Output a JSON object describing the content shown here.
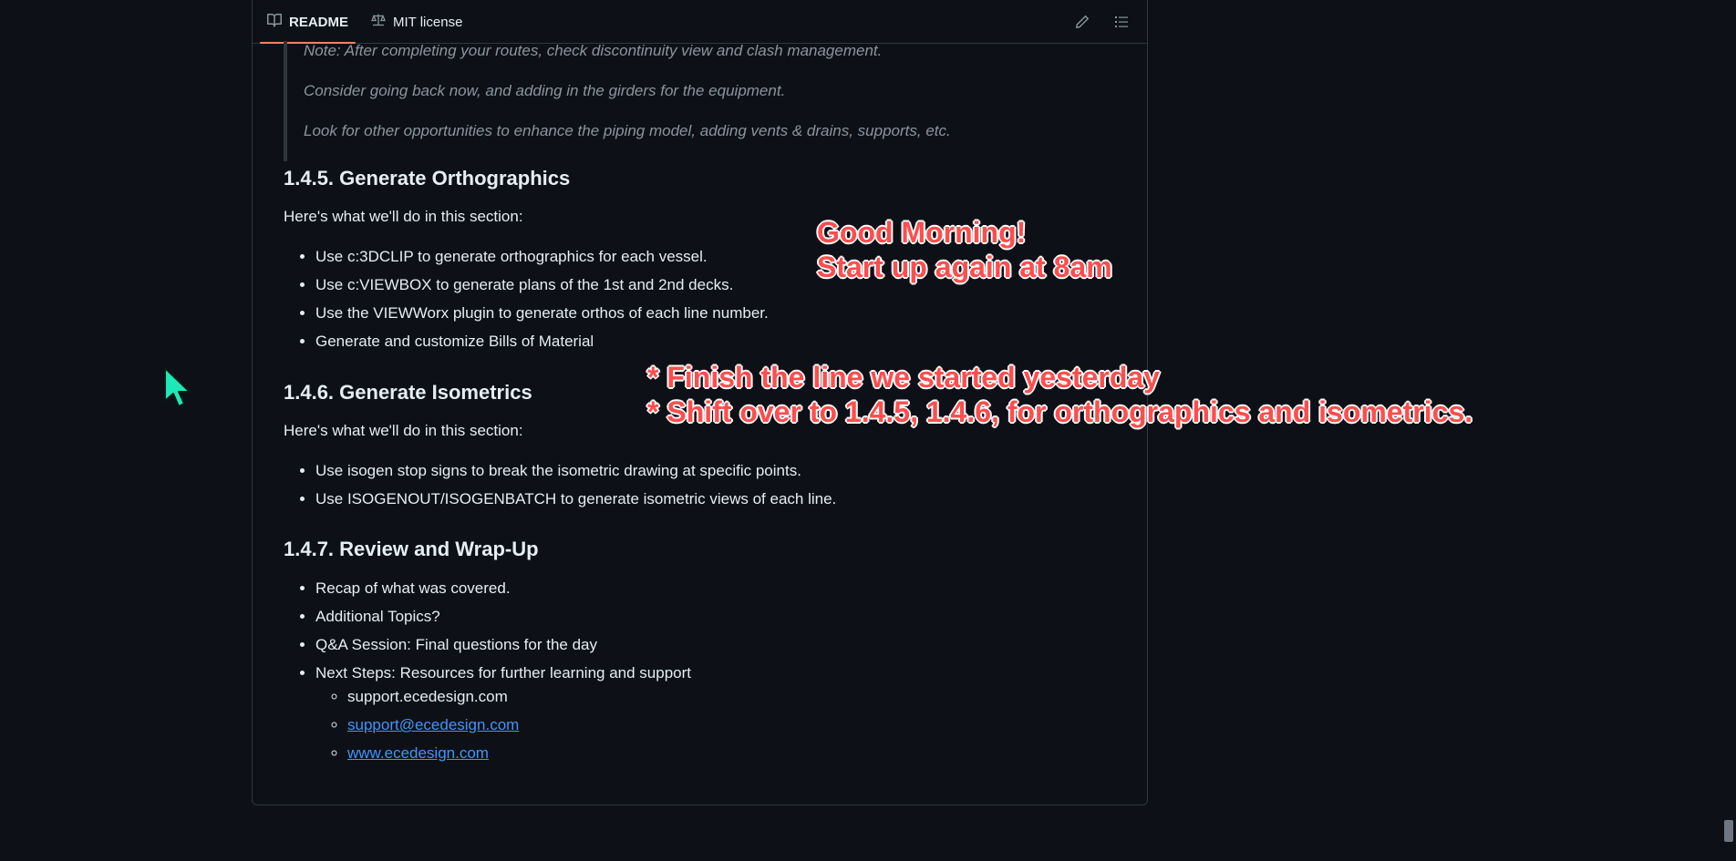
{
  "tabs": {
    "readme": "README",
    "license": "MIT license"
  },
  "quote": [
    "Note: After completing your routes, check discontinuity view and clash management.",
    "Consider going back now, and adding in the girders for the equipment.",
    "Look for other opportunities to enhance the piping model, adding vents & drains, supports, etc."
  ],
  "sections": {
    "s145": {
      "heading": "1.4.5. Generate Orthographics",
      "intro": "Here's what we'll do in this section:",
      "items": [
        "Use c:3DCLIP to generate orthographics for each vessel.",
        "Use c:VIEWBOX to generate plans of the 1st and 2nd decks.",
        "Use the VIEWWorx plugin to generate orthos of each line number.",
        "Generate and customize Bills of Material"
      ]
    },
    "s146": {
      "heading": "1.4.6. Generate Isometrics",
      "intro": "Here's what we'll do in this section:",
      "items": [
        "Use isogen stop signs to break the isometric drawing at specific points.",
        "Use ISOGENOUT/ISOGENBATCH to generate isometric views of each line."
      ]
    },
    "s147": {
      "heading": "1.4.7. Review and Wrap-Up",
      "items": [
        "Recap of what was covered.",
        "Additional Topics?",
        "Q&A Session: Final questions for the day",
        "Next Steps: Resources for further learning and support"
      ],
      "subitems": {
        "plain": "support.ecedesign.com",
        "email": "support@ecedesign.com",
        "web": "www.ecedesign.com"
      }
    }
  },
  "overlay": {
    "line1": "Good Morning!",
    "line2": "Start up again at 8am",
    "line3": "* Finish the line we started yesterday",
    "line4": "* Shift over to 1.4.5, 1.4.6, for orthographics and isometrics."
  },
  "colors": {
    "background": "#0d1117",
    "text": "#e6edf3",
    "muted": "#8b949e",
    "link": "#4493f8",
    "tab_underline": "#f78166",
    "overlay_text": "#ff4d4d",
    "cursor": "#1de9b6"
  },
  "icons": {
    "readme": "book-icon",
    "license": "scale-icon",
    "edit": "pencil-icon",
    "toc": "list-icon"
  }
}
